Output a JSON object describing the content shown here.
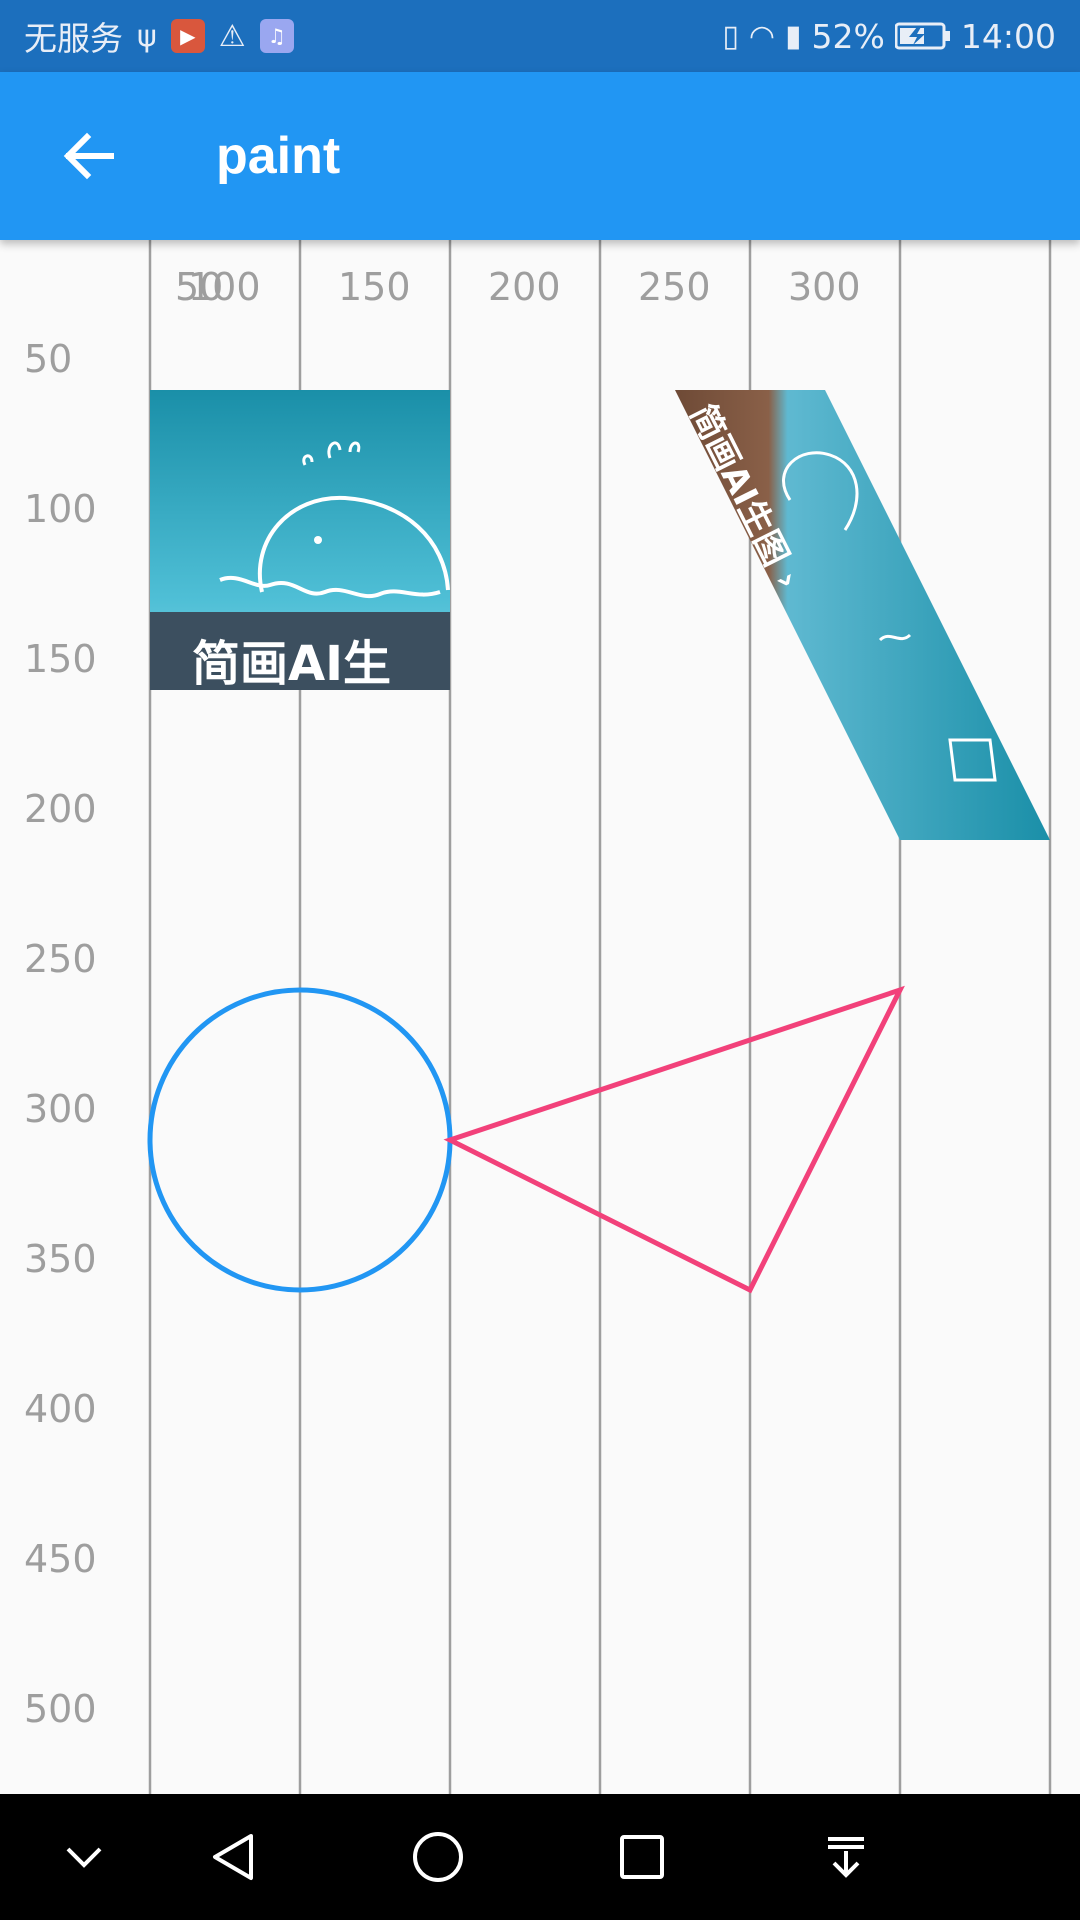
{
  "status_bar": {
    "carrier": "无服务",
    "battery": "52%",
    "time": "14:00"
  },
  "app_bar": {
    "title": "paint"
  },
  "canvas": {
    "x_labels": [
      "50",
      "100",
      "150",
      "200",
      "250",
      "300"
    ],
    "y_labels": [
      "50",
      "100",
      "150",
      "200",
      "250",
      "300",
      "350",
      "400",
      "450",
      "500"
    ],
    "image_caption": "简画AI生",
    "skewed_image_caption": "简画AI生图 ›",
    "colors": {
      "vertical_grid": "#9e9e9e",
      "horizontal_grid_gradient": [
        "#f44336",
        "#ff9800",
        "#ffeb3b",
        "#8bc34a",
        "#2196f3"
      ],
      "circle": "#2196f3",
      "triangle": "#f2417a"
    }
  }
}
